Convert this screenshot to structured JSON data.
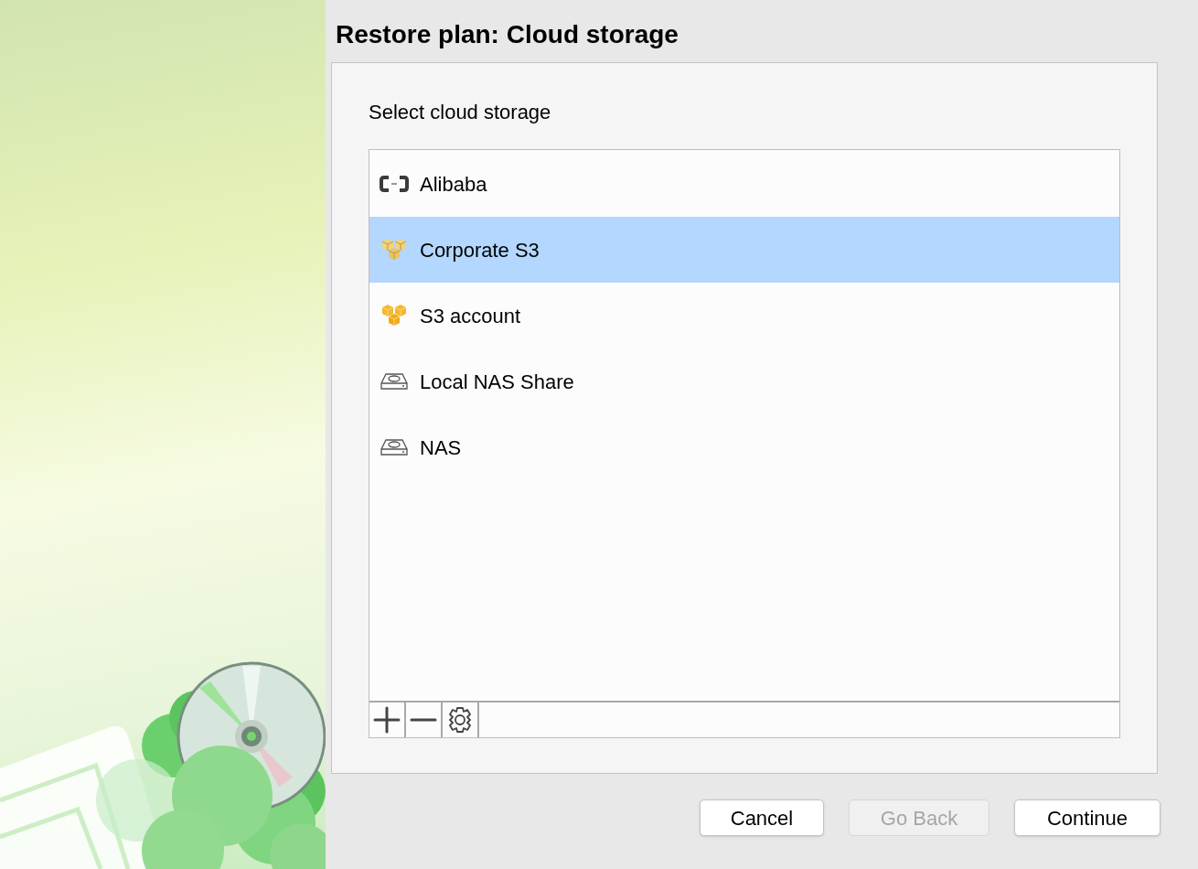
{
  "title": "Restore plan: Cloud storage",
  "prompt": "Select cloud storage",
  "storages": [
    {
      "label": "Alibaba",
      "kind": "alibaba",
      "selected": false
    },
    {
      "label": "Corporate S3",
      "kind": "s3",
      "selected": true
    },
    {
      "label": "S3 account",
      "kind": "s3",
      "selected": false
    },
    {
      "label": "Local NAS Share",
      "kind": "nas",
      "selected": false
    },
    {
      "label": "NAS",
      "kind": "nas",
      "selected": false
    }
  ],
  "toolbar": [
    {
      "kind": "add"
    },
    {
      "kind": "remove"
    },
    {
      "kind": "settings"
    }
  ],
  "buttons": [
    {
      "label": "Cancel",
      "disabled": false
    },
    {
      "label": "Go Back",
      "disabled": true
    },
    {
      "label": "Continue",
      "disabled": false
    }
  ]
}
